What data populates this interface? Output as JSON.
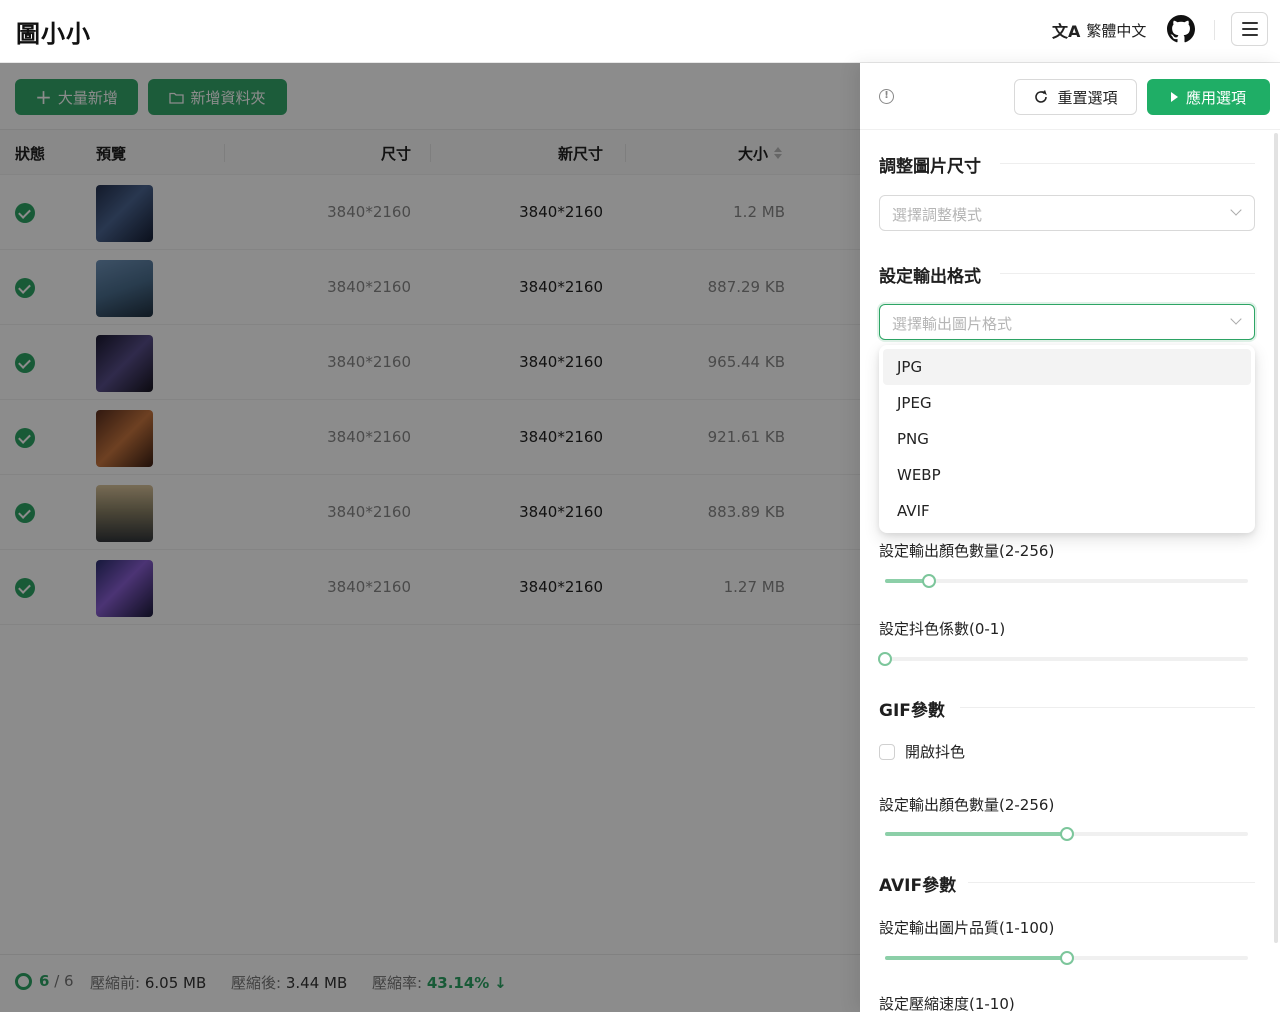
{
  "header": {
    "logo": "圖小小",
    "language": "繁體中文",
    "translate_icon": "translate-icon",
    "github_icon": "github-icon",
    "menu_icon": "hamburger-menu-icon"
  },
  "toolbar": {
    "bulk_add_label": "大量新增",
    "add_folder_label": "新增資料夾"
  },
  "table": {
    "columns": {
      "status": "狀態",
      "preview": "預覽",
      "size": "尺寸",
      "new_size": "新尺寸",
      "file_size": "大小"
    },
    "rows": [
      {
        "size": "3840*2160",
        "new_size": "3840*2160",
        "file_size": "1.2 MB"
      },
      {
        "size": "3840*2160",
        "new_size": "3840*2160",
        "file_size": "887.29 KB"
      },
      {
        "size": "3840*2160",
        "new_size": "3840*2160",
        "file_size": "965.44 KB"
      },
      {
        "size": "3840*2160",
        "new_size": "3840*2160",
        "file_size": "921.61 KB"
      },
      {
        "size": "3840*2160",
        "new_size": "3840*2160",
        "file_size": "883.89 KB"
      },
      {
        "size": "3840*2160",
        "new_size": "3840*2160",
        "file_size": "1.27 MB"
      }
    ]
  },
  "footer": {
    "done": "6",
    "total": "/ 6",
    "before_label": "壓縮前:",
    "before_value": "6.05 MB",
    "after_label": "壓縮後:",
    "after_value": "3.44 MB",
    "rate_label": "壓縮率:",
    "rate_value": "43.14%",
    "rate_arrow": "↓"
  },
  "drawer": {
    "reset_label": "重置選項",
    "apply_label": "應用選項",
    "resize_title": "調整圖片尺寸",
    "resize_placeholder": "選擇調整模式",
    "format_title": "設定輸出格式",
    "format_placeholder": "選擇輸出圖片格式",
    "format_options": [
      "JPG",
      "JPEG",
      "PNG",
      "WEBP",
      "AVIF"
    ],
    "png_colors_label": "設定輸出顏色數量(2-256)",
    "png_colors_value": 0.12,
    "dither_label": "設定抖色係數(0-1)",
    "dither_value": 0,
    "gif_title": "GIF參數",
    "gif_dither_label": "開啟抖色",
    "gif_colors_label": "設定輸出顏色數量(2-256)",
    "gif_colors_value": 0.5,
    "avif_title": "AVIF參數",
    "avif_quality_label": "設定輸出圖片品質(1-100)",
    "avif_quality_value": 0.5,
    "avif_speed_label": "設定壓縮速度(1-10)"
  },
  "colors": {
    "brand_green": "#34a86b",
    "apply_green": "#1fae66",
    "status_green": "#2da565"
  }
}
